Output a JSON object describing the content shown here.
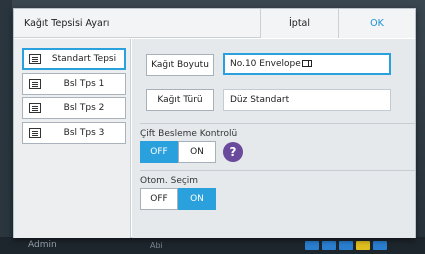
{
  "background": {
    "user_label": "Admin",
    "status_label": "Abi"
  },
  "dialog": {
    "title": "Kağıt Tepsisi Ayarı",
    "cancel_label": "İptal",
    "ok_label": "OK"
  },
  "trays": [
    {
      "label": "Standart Tepsi",
      "selected": true
    },
    {
      "label": "Bsl Tps 1",
      "selected": false
    },
    {
      "label": "Bsl Tps 2",
      "selected": false
    },
    {
      "label": "Bsl Tps 3",
      "selected": false
    }
  ],
  "settings": {
    "paper_size": {
      "button_label": "Kağıt Boyutu",
      "value": "No.10 Envelope"
    },
    "paper_type": {
      "button_label": "Kağıt Türü",
      "value": "Düz Standart"
    },
    "duplex_feed": {
      "label": "Çift Besleme Kontrolü",
      "off_label": "OFF",
      "on_label": "ON",
      "selected": "OFF",
      "help_glyph": "?"
    },
    "auto_select": {
      "label": "Otom. Seçim",
      "off_label": "OFF",
      "on_label": "ON",
      "selected": "ON"
    }
  },
  "colors": {
    "accent": "#2aa0dc",
    "help": "#6a4a9c"
  }
}
